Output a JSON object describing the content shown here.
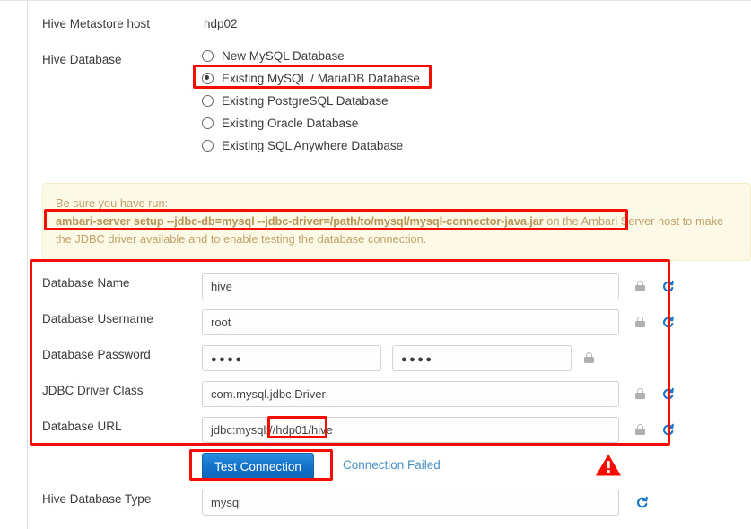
{
  "form": {
    "metastore_host": {
      "label": "Hive Metastore host",
      "value": "hdp02"
    },
    "hive_database": {
      "label": "Hive Database",
      "options": [
        {
          "label": "New MySQL Database",
          "selected": false
        },
        {
          "label": "Existing MySQL / MariaDB Database",
          "selected": true
        },
        {
          "label": "Existing PostgreSQL Database",
          "selected": false
        },
        {
          "label": "Existing Oracle Database",
          "selected": false
        },
        {
          "label": "Existing SQL Anywhere Database",
          "selected": false
        }
      ]
    },
    "notice": {
      "lead": "Be sure you have run:",
      "command": "ambari-server setup --jdbc-db=mysql --jdbc-driver=/path/to/mysql/mysql-connector-java.jar",
      "trailing": " on the Ambari Server host to make the JDBC driver available and to enable testing the database connection."
    },
    "fields": {
      "database_name": {
        "label": "Database Name",
        "value": "hive",
        "lock_icon": "lock-icon",
        "refresh_icon": "refresh-icon"
      },
      "database_username": {
        "label": "Database Username",
        "value": "root",
        "lock_icon": "lock-icon",
        "refresh_icon": "refresh-icon"
      },
      "database_password": {
        "label": "Database Password",
        "value": "●●●●",
        "confirm_value": "●●●●",
        "lock_icon": "lock-icon"
      },
      "jdbc_driver_class": {
        "label": "JDBC Driver Class",
        "value": "com.mysql.jdbc.Driver",
        "lock_icon": "lock-icon",
        "refresh_icon": "refresh-icon"
      },
      "database_url": {
        "label": "Database URL",
        "value": "jdbc:mysql://hdp01/hive",
        "lock_icon": "lock-icon",
        "refresh_icon": "refresh-icon"
      },
      "hive_database_type": {
        "label": "Hive Database Type",
        "value": "mysql",
        "refresh_icon": "refresh-icon"
      }
    },
    "test_connection": {
      "button_label": "Test Connection",
      "status_text": "Connection Failed",
      "warning_icon": "warning-triangle-icon"
    }
  },
  "colors": {
    "annotation": "#f50d02",
    "primary_button": "#1272c9",
    "link": "#4a90c4",
    "notice_bg": "#fdf9e7",
    "notice_text": "#c0a16b",
    "refresh_icon": "#1878c8",
    "warning": "#fb0a00"
  }
}
